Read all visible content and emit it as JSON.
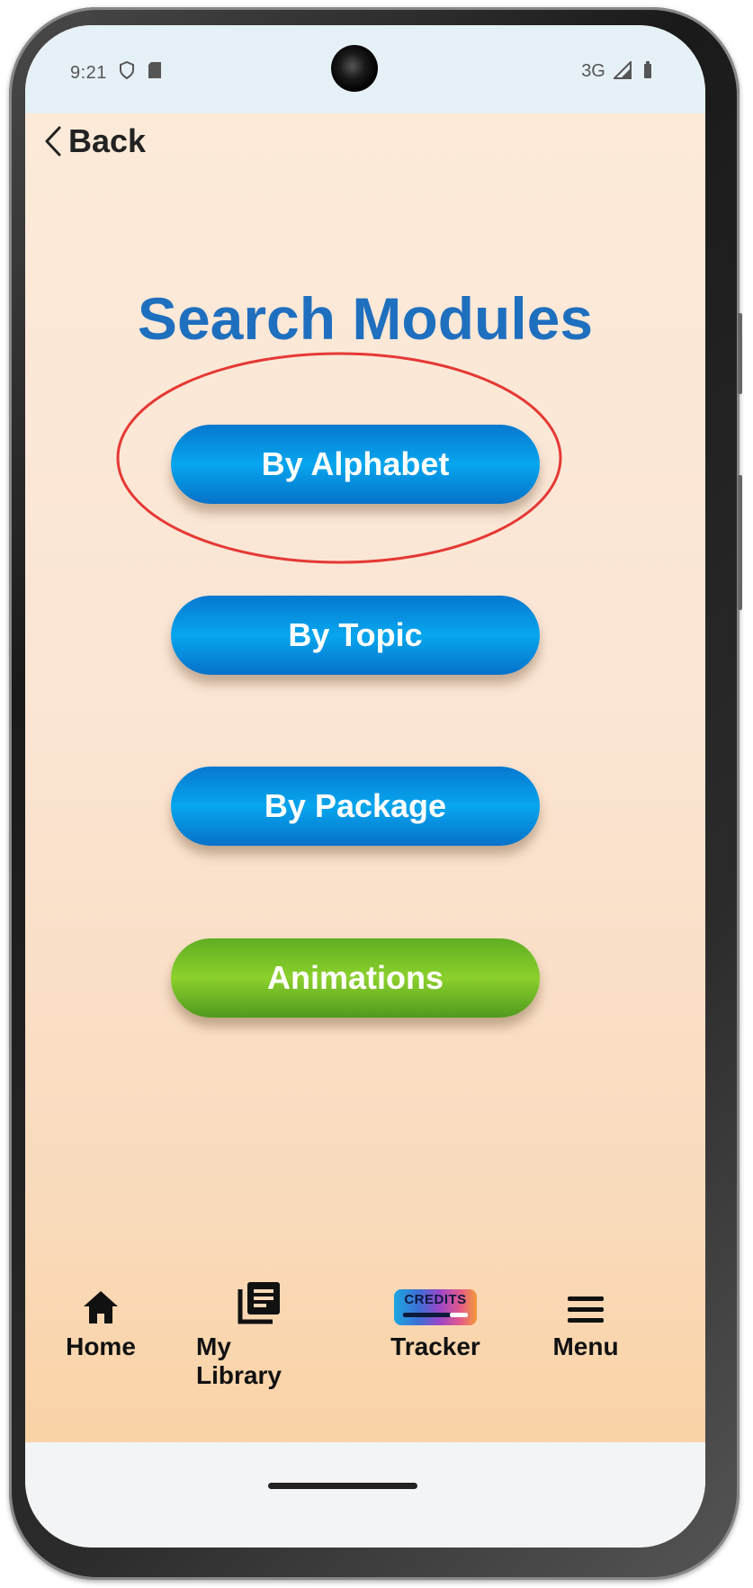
{
  "status_bar": {
    "time": "9:21",
    "network": "3G"
  },
  "header": {
    "back_label": "Back"
  },
  "main": {
    "title": "Search Modules",
    "buttons": [
      {
        "label": "By Alphabet"
      },
      {
        "label": "By Topic"
      },
      {
        "label": "By Package"
      },
      {
        "label": "Animations"
      }
    ]
  },
  "tabbar": {
    "items": [
      {
        "label": "Home",
        "icon": "home-icon"
      },
      {
        "label": "My Library",
        "icon": "library-icon"
      },
      {
        "label": "Tracker",
        "icon": "credits-tracker-icon",
        "badge": "CREDITS"
      },
      {
        "label": "Menu",
        "icon": "hamburger-menu-icon"
      }
    ]
  },
  "colors": {
    "title": "#1f6fbf",
    "button_blue": "#07a6ee",
    "button_green": "#8bd02c",
    "highlight_ring": "#e53935"
  }
}
